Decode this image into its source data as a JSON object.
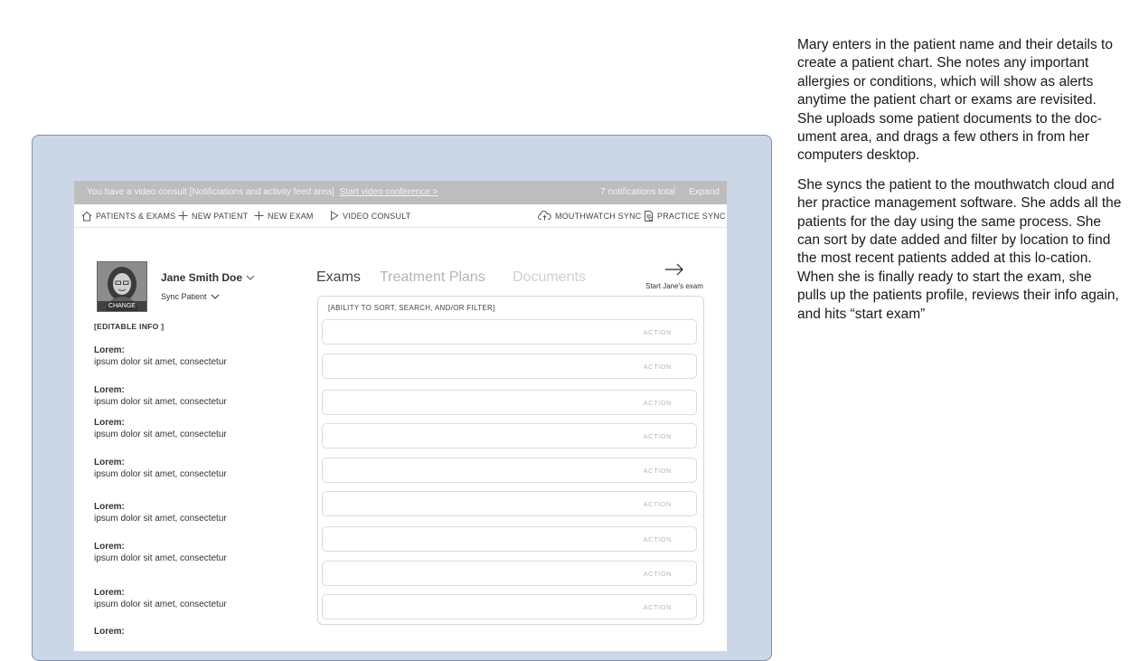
{
  "notification": {
    "message": "You have a video consult [Notificiations and activity feed area]",
    "link": "Start video conference >",
    "count": "7 notifications total",
    "expand": "Expand"
  },
  "nav": {
    "patients_exams": "PATIENTS & EXAMS",
    "new_patient": "NEW PATIENT",
    "new_exam": "NEW EXAM",
    "video_consult": "VIDEO CONSULT",
    "mouthwatch_sync": "MOUTHWATCH SYNC",
    "practice_sync": "PRACTICE SYNC"
  },
  "patient": {
    "name": "Jane Smith Doe",
    "change": "CHANGE",
    "sync": "Sync Patient",
    "editable": "[EDITABLE INFO ]",
    "fields": [
      {
        "label": "Lorem:",
        "value": "ipsum dolor sit amet, consectetur"
      },
      {
        "label": "Lorem:",
        "value": "ipsum dolor sit amet, consectetur"
      },
      {
        "label": "Lorem:",
        "value": "ipsum dolor sit amet, consectetur"
      },
      {
        "label": "Lorem:",
        "value": "ipsum dolor sit amet, consectetur"
      },
      {
        "label": "Lorem:",
        "value": "ipsum dolor sit amet, consectetur"
      },
      {
        "label": "Lorem:",
        "value": "ipsum dolor sit amet, consectetur"
      },
      {
        "label": "Lorem:",
        "value": "ipsum dolor sit amet, consectetur"
      },
      {
        "label": "Lorem:",
        "value": ""
      }
    ]
  },
  "tabs": {
    "exams": "Exams",
    "treatment_plans": "Treatment Plans",
    "documents": "Documents"
  },
  "start_exam": "Start Jane's exam",
  "exams_panel": {
    "sort_hint": "[ABILITY TO SORT, SEARCH, AND/OR FILTER]",
    "rows": [
      "ACTION",
      "ACTION",
      "ACTION",
      "ACTION",
      "ACTION",
      "ACTION",
      "ACTION",
      "ACTION",
      "ACTION"
    ]
  },
  "narrative": {
    "p1": "Mary enters in the patient name and their details to create a patient chart. She notes any important allergies or conditions, which will show as alerts anytime the patient chart or exams are revisited. She uploads some patient documents to the doc-ument area, and drags a few others in from her computers desktop.",
    "p2": "She syncs the patient to the mouthwatch cloud and her practice management software. She adds all the patients for the day using the same process. She can sort by date added and filter by location to find the most recent patients added at this lo-cation. When she is finally ready to start the exam, she pulls up the patients profile, reviews their info again, and hits “start exam”"
  }
}
